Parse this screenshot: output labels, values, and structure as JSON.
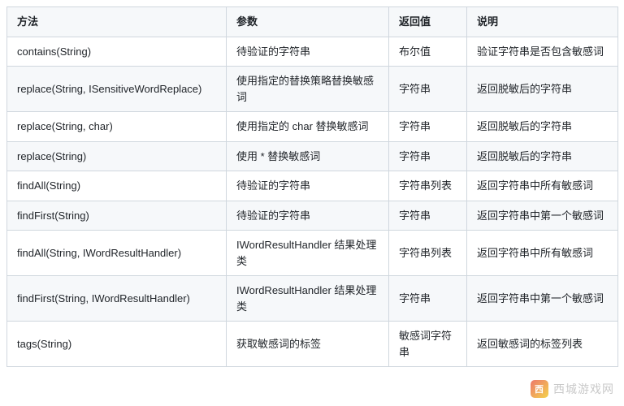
{
  "table": {
    "headers": [
      "方法",
      "参数",
      "返回值",
      "说明"
    ],
    "rows": [
      {
        "method": "contains(String)",
        "param": "待验证的字符串",
        "ret": "布尔值",
        "desc": "验证字符串是否包含敏感词"
      },
      {
        "method": "replace(String, ISensitiveWordReplace)",
        "param": "使用指定的替换策略替换敏感词",
        "ret": "字符串",
        "desc": "返回脱敏后的字符串"
      },
      {
        "method": "replace(String, char)",
        "param": "使用指定的 char 替换敏感词",
        "ret": "字符串",
        "desc": "返回脱敏后的字符串"
      },
      {
        "method": "replace(String)",
        "param": "使用 * 替换敏感词",
        "ret": "字符串",
        "desc": "返回脱敏后的字符串"
      },
      {
        "method": "findAll(String)",
        "param": "待验证的字符串",
        "ret": "字符串列表",
        "desc": "返回字符串中所有敏感词"
      },
      {
        "method": "findFirst(String)",
        "param": "待验证的字符串",
        "ret": "字符串",
        "desc": "返回字符串中第一个敏感词"
      },
      {
        "method": "findAll(String, IWordResultHandler)",
        "param": "IWordResultHandler 结果处理类",
        "ret": "字符串列表",
        "desc": "返回字符串中所有敏感词"
      },
      {
        "method": "findFirst(String, IWordResultHandler)",
        "param": "IWordResultHandler 结果处理类",
        "ret": "字符串",
        "desc": "返回字符串中第一个敏感词"
      },
      {
        "method": "tags(String)",
        "param": "获取敏感词的标签",
        "ret": "敏感词字符串",
        "desc": "返回敏感词的标签列表"
      }
    ]
  },
  "watermark": {
    "badge": "西",
    "text": "西城游戏网"
  }
}
